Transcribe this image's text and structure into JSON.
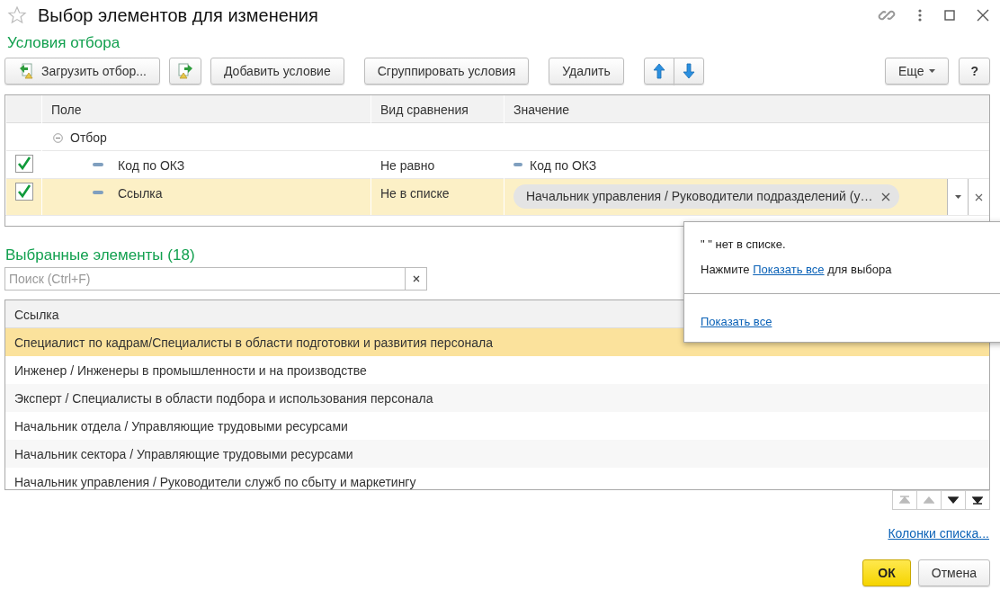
{
  "window": {
    "title": "Выбор элементов для изменения",
    "favorite": false
  },
  "filter_section": {
    "title": "Условия отбора"
  },
  "toolbar": [
    {
      "kind": "load",
      "label": "Загрузить отбор..."
    },
    {
      "kind": "save"
    },
    {
      "kind": "text",
      "label": "Добавить условие"
    },
    {
      "kind": "text",
      "label": "Сгруппировать условия"
    },
    {
      "kind": "text",
      "label": "Удалить"
    },
    {
      "kind": "move"
    },
    {
      "kind": "menu",
      "label": "Еще"
    },
    {
      "kind": "help",
      "label": "?"
    }
  ],
  "filter_table": {
    "columns": [
      "Поле",
      "Вид сравнения",
      "Значение"
    ],
    "rows": [
      {
        "kind": "group",
        "field": "Отбор",
        "expanded": true,
        "children": [
          {
            "kind": "condition",
            "checked": true,
            "selected": false,
            "field": "Код по ОКЗ",
            "comparison": "Не равно",
            "value": {
              "kind": "field",
              "text": "Код по ОКЗ"
            }
          },
          {
            "kind": "condition",
            "checked": true,
            "selected": true,
            "field": "Ссылка",
            "comparison": "Не в списке",
            "value": {
              "kind": "tag",
              "text": "Начальник управления / Руководители подразделений (у…"
            }
          }
        ]
      }
    ]
  },
  "popup": {
    "message": "\"  \" нет в списке.",
    "hint_before": "Нажмите",
    "hint_link": "Показать все",
    "hint_after": "для выбора",
    "footer_link": "Показать все"
  },
  "selected_section": {
    "title": "Выбранные элементы (18)",
    "search_placeholder": "Поиск (Ctrl+F)",
    "columns": [
      "Ссылка"
    ],
    "rows": [
      {
        "text": "Специалист по кадрам/Специалисты в области подготовки и развития персонала",
        "selected": true
      },
      {
        "text": "Инженер / Инженеры в промышленности и на производстве",
        "selected": false
      },
      {
        "text": "Эксперт / Специалисты в области подбора и использования персонала",
        "selected": false
      },
      {
        "text": "Начальник отдела / Управляющие трудовыми ресурсами",
        "selected": false
      },
      {
        "text": "Начальник сектора / Управляющие трудовыми ресурсами",
        "selected": false
      },
      {
        "text": "Начальник управления / Руководители служб по сбыту и маркетингу",
        "selected": false
      }
    ],
    "navigation": [
      {
        "kind": "first",
        "disabled": true
      },
      {
        "kind": "prev",
        "disabled": true
      },
      {
        "kind": "next",
        "disabled": false
      },
      {
        "kind": "last",
        "disabled": false
      }
    ]
  },
  "columns_link": "Колонки списка...",
  "buttons": [
    {
      "kind": "primary",
      "label": "ОК"
    },
    {
      "kind": "default",
      "label": "Отмена"
    }
  ]
}
